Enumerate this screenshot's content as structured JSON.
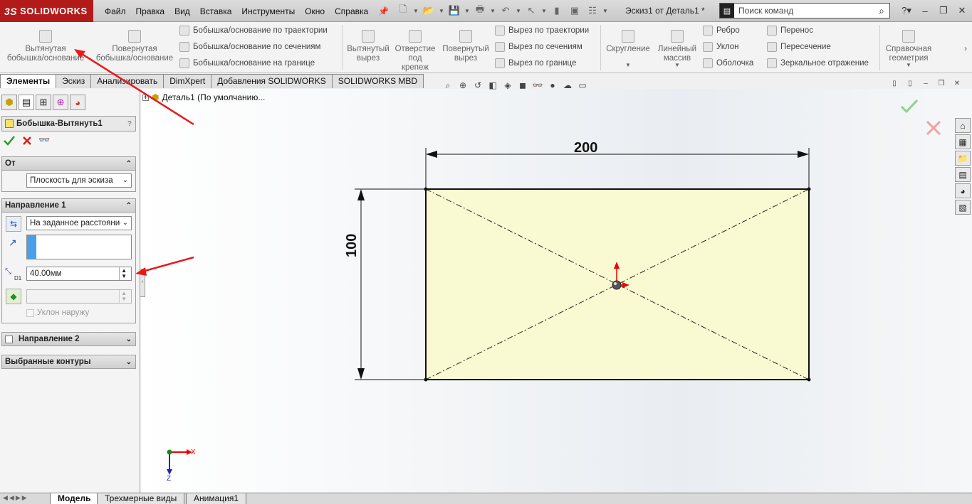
{
  "app": {
    "logo": "SOLIDWORKS",
    "logo_prefix": "3S",
    "doc_title": "Эскиз1 от Деталь1 *"
  },
  "menu": [
    "Файл",
    "Правка",
    "Вид",
    "Вставка",
    "Инструменты",
    "Окно",
    "Справка"
  ],
  "search": {
    "placeholder": "Поиск команд"
  },
  "ribbon": {
    "extrude_boss": [
      "Вытянутая",
      "бобышка/основание"
    ],
    "revolve_boss": [
      "Повернутая",
      "бобышка/основание"
    ],
    "sweep_boss": "Бобышка/основание по траектории",
    "loft_boss": "Бобышка/основание по сечениям",
    "boundary_boss": "Бобышка/основание на границе",
    "extruded_cut": [
      "Вытянутый",
      "вырез"
    ],
    "hole_wizard": [
      "Отверстие",
      "под",
      "крепеж"
    ],
    "revolved_cut": [
      "Повернутый",
      "вырез"
    ],
    "swept_cut": "Вырез по траектории",
    "lofted_cut": "Вырез по сечениям",
    "boundary_cut": "Вырез по границе",
    "fillet": "Скругление",
    "linear_pattern": [
      "Линейный",
      "массив"
    ],
    "rib": "Ребро",
    "draft": "Уклон",
    "shell": "Оболочка",
    "wrap": "Перенос",
    "intersect": "Пересечение",
    "mirror": "Зеркальное отражение",
    "ref_geometry": [
      "Справочная",
      "геометрия"
    ]
  },
  "command_tabs": [
    "Элементы",
    "Эскиз",
    "Анализировать",
    "DimXpert",
    "Добавления SOLIDWORKS",
    "SOLIDWORKS MBD"
  ],
  "tree": {
    "root": "Деталь1  (По умолчанию..."
  },
  "property_manager": {
    "title": "Бобышка-Вытянуть1",
    "help": "?",
    "from": {
      "header": "От",
      "value": "Плоскость для эскиза"
    },
    "direction1": {
      "header": "Направление 1",
      "end_condition": "На заданное расстояние",
      "depth_value": "40.00мм",
      "depth_label": "D1",
      "draft_outward": "Уклон наружу"
    },
    "direction2": {
      "header": "Направление 2"
    },
    "contours": {
      "header": "Выбранные контуры"
    }
  },
  "sketch": {
    "width_dim": "200",
    "height_dim": "100",
    "width_mm": 200,
    "height_mm": 100
  },
  "triad": {
    "x": "X",
    "z": "Z"
  },
  "bottom_tabs": [
    "Модель",
    "Трехмерные виды",
    "Анимация1"
  ],
  "colors": {
    "brand": "#b31b1b",
    "sketch_fill": "#fafad2",
    "annotation_arrow": "#e8191c",
    "accept": "#3aa63a",
    "cancel": "#d81c1c"
  }
}
